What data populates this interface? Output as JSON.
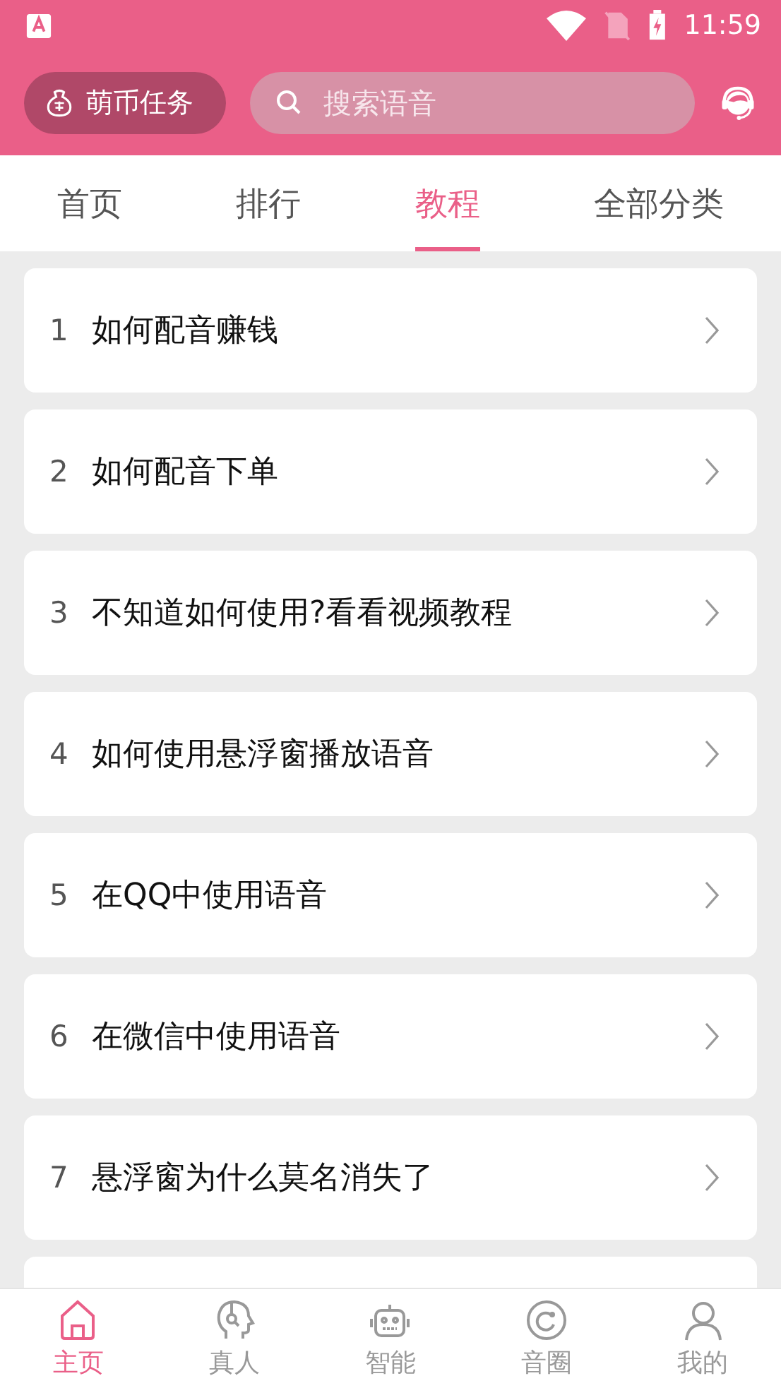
{
  "status_bar": {
    "time": "11:59"
  },
  "header": {
    "task_button": "萌币任务",
    "search": {
      "placeholder": "搜索语音"
    }
  },
  "tabs": [
    {
      "label": "首页",
      "selected": false
    },
    {
      "label": "排行",
      "selected": false
    },
    {
      "label": "教程",
      "selected": true
    },
    {
      "label": "全部分类",
      "selected": false
    }
  ],
  "tutorials": [
    {
      "number": "1",
      "title": "如何配音赚钱"
    },
    {
      "number": "2",
      "title": "如何配音下单"
    },
    {
      "number": "3",
      "title": "不知道如何使用?看看视频教程"
    },
    {
      "number": "4",
      "title": "如何使用悬浮窗播放语音"
    },
    {
      "number": "5",
      "title": "在QQ中使用语音"
    },
    {
      "number": "6",
      "title": "在微信中使用语音"
    },
    {
      "number": "7",
      "title": "悬浮窗为什么莫名消失了"
    }
  ],
  "bottom_nav": [
    {
      "kind": "home",
      "label": "主页",
      "selected": true
    },
    {
      "kind": "human",
      "label": "真人",
      "selected": false
    },
    {
      "kind": "robot",
      "label": "智能",
      "selected": false
    },
    {
      "kind": "circle",
      "label": "音圈",
      "selected": false
    },
    {
      "kind": "user",
      "label": "我的",
      "selected": false
    }
  ]
}
